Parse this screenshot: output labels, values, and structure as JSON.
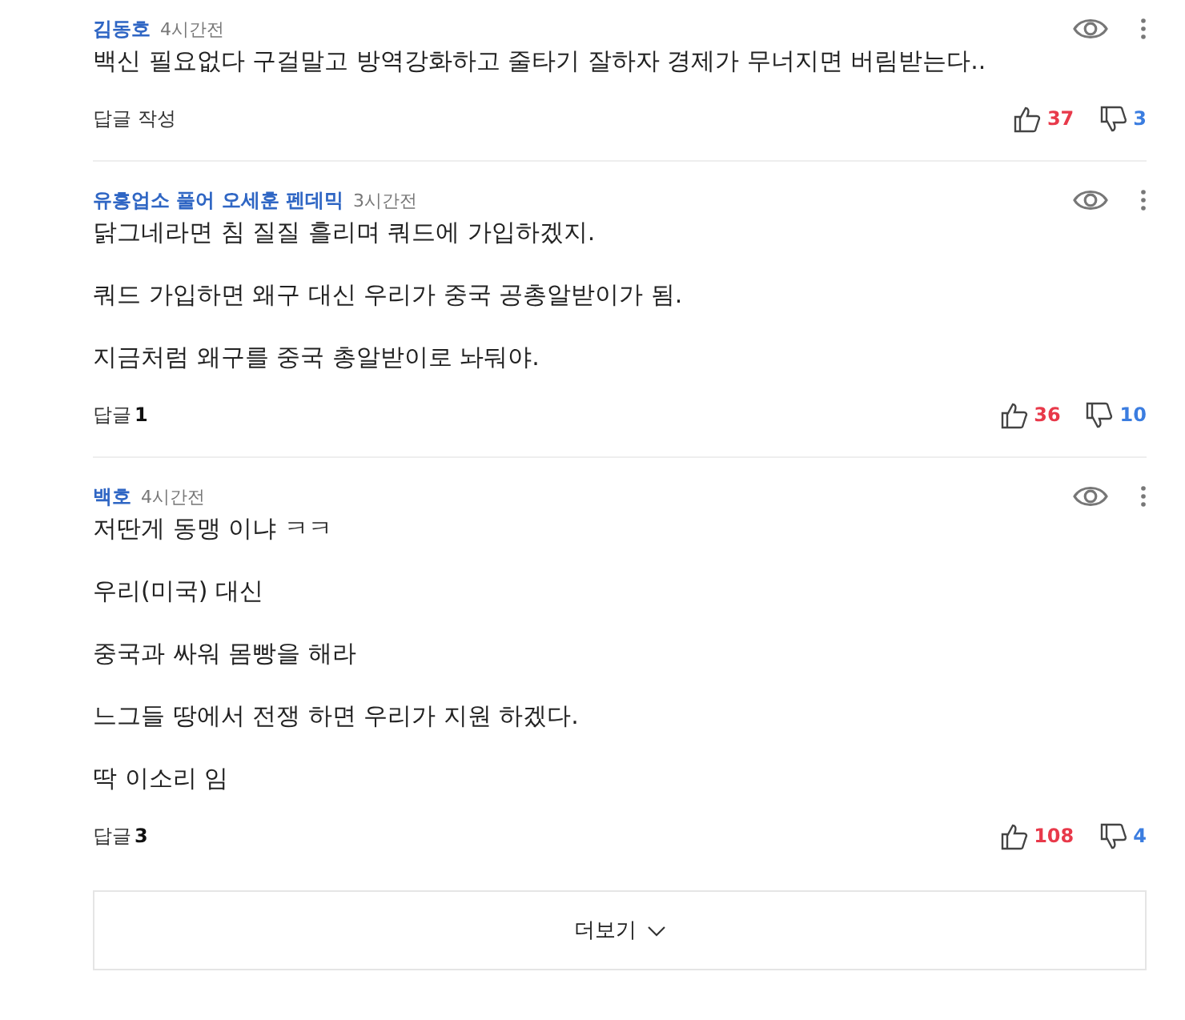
{
  "comments": [
    {
      "author": "김동호",
      "time": "4시간전",
      "paragraphs": [
        "백신 필요없다 구걸말고 방역강화하고  줄타기 잘하자 경제가 무너지면 버림받는다.."
      ],
      "reply_label": "답글 작성",
      "likes": "37",
      "dislikes": "3"
    },
    {
      "author": "유흥업소 풀어 오세훈 펜데믹",
      "time": "3시간전",
      "paragraphs": [
        "닭그네라면 침 질질 흘리며 쿼드에 가입하겠지.",
        "쿼드 가입하면 왜구 대신 우리가 중국 공총알받이가 됨.",
        "지금처럼 왜구를 중국 총알받이로 놔둬야."
      ],
      "reply_label": "답글",
      "reply_count": "1",
      "likes": "36",
      "dislikes": "10"
    },
    {
      "author": "백호",
      "time": "4시간전",
      "paragraphs": [
        "저딴게 동맹 이냐 ㅋㅋ",
        "우리(미국) 대신",
        "중국과 싸워 몸빵을 해라",
        "느그들 땅에서 전쟁 하면 우리가 지원 하겠다.",
        "딱 이소리 임"
      ],
      "reply_label": "답글",
      "reply_count": "3",
      "likes": "108",
      "dislikes": "4"
    }
  ],
  "more_button": "더보기"
}
